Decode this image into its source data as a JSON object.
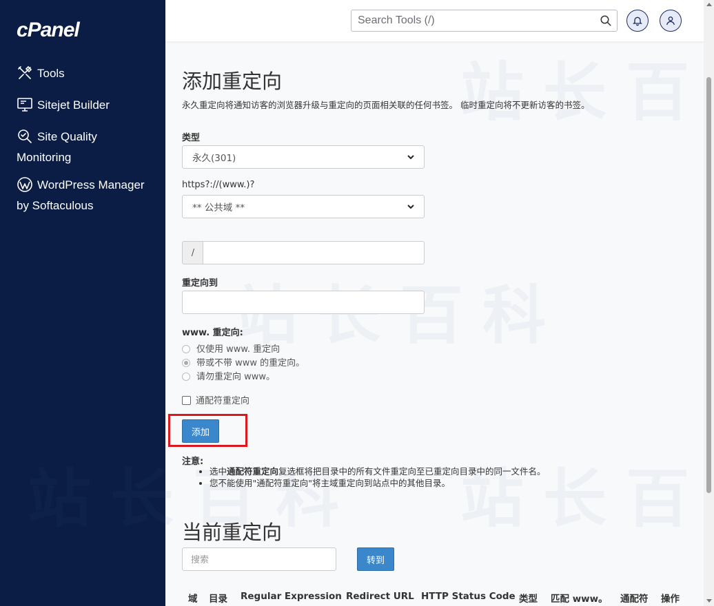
{
  "sidebar": {
    "logo": "cPanel",
    "items": [
      {
        "label": "Tools",
        "icon": "tools-icon"
      },
      {
        "label": "Sitejet Builder",
        "icon": "monitor-icon"
      },
      {
        "label": "Site Quality",
        "label2": "Monitoring",
        "icon": "magnify-check-icon"
      },
      {
        "label": "WordPress Manager",
        "label2": "by Softaculous",
        "icon": "wordpress-icon"
      }
    ]
  },
  "header": {
    "search_placeholder": "Search Tools (/)"
  },
  "watermark": "站长百科",
  "form": {
    "title": "添加重定向",
    "description": "永久重定向将通知访客的浏览器升级与重定向的页面相关联的任何书签。 临时重定向将不更新访客的书签。",
    "type_label": "类型",
    "type_value": "永久(301)",
    "domain_label": "https?://(www.)?",
    "domain_value": "** 公共域 **",
    "path_prefix": "/",
    "redirect_to_label": "重定向到",
    "www_label": "www. 重定向:",
    "www_options": [
      {
        "label": "仅使用 www. 重定向",
        "checked": false
      },
      {
        "label": "带或不带 www 的重定向。",
        "checked": true
      },
      {
        "label": "请勿重定向 www。",
        "checked": false
      }
    ],
    "wildcard_label": "通配符重定向",
    "add_button": "添加"
  },
  "note": {
    "title": "注意:",
    "item1_prefix": "选中",
    "item1_bold": "通配符重定向",
    "item1_suffix": "复选框将把目录中的所有文件重定向至已重定向目录中的同一文件名。",
    "item2": "您不能使用\"通配符重定向\"将主域重定向到站点中的其他目录。"
  },
  "current": {
    "title": "当前重定向",
    "search_placeholder": "搜索",
    "go_button": "转到",
    "columns": [
      "域",
      "目录",
      "Regular Expression",
      "Redirect URL",
      "HTTP Status Code",
      "类型",
      "匹配 www。",
      "通配符",
      "操作"
    ]
  },
  "colors": {
    "sidebar_bg": "#0b1d44",
    "primary": "#3a87cc",
    "highlight": "#d9181f"
  }
}
